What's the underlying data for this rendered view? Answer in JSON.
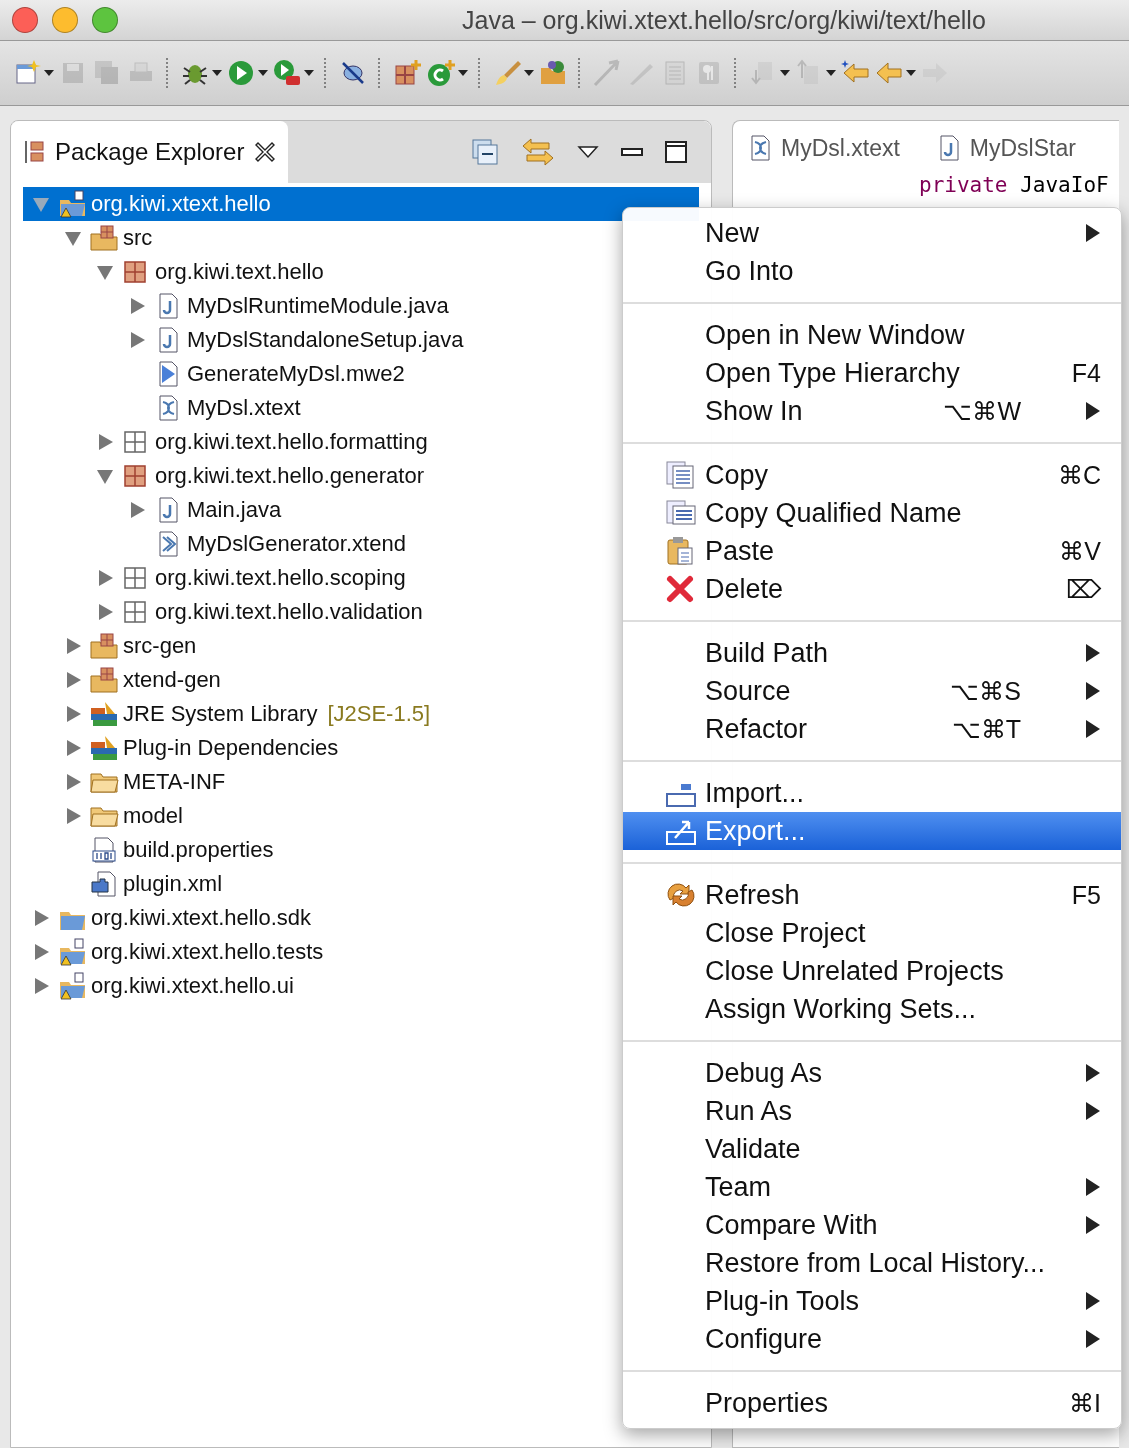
{
  "window": {
    "title": "Java – org.kiwi.xtext.hello/src/org/kiwi/text/hello"
  },
  "toolbar": [
    {
      "kind": "new",
      "disabled": false,
      "dropdown": true,
      "group_end": false
    },
    {
      "kind": "save",
      "disabled": true,
      "dropdown": false,
      "group_end": false
    },
    {
      "kind": "save-all",
      "disabled": true,
      "dropdown": false,
      "group_end": false
    },
    {
      "kind": "print",
      "disabled": true,
      "dropdown": false,
      "group_end": true
    },
    {
      "kind": "debug",
      "disabled": false,
      "dropdown": true,
      "group_end": false
    },
    {
      "kind": "run",
      "disabled": false,
      "dropdown": true,
      "group_end": false
    },
    {
      "kind": "run-tool",
      "disabled": false,
      "dropdown": true,
      "group_end": true
    },
    {
      "kind": "skip",
      "disabled": false,
      "dropdown": false,
      "group_end": true
    },
    {
      "kind": "new-package",
      "disabled": false,
      "dropdown": false,
      "group_end": false
    },
    {
      "kind": "new-class",
      "disabled": false,
      "dropdown": true,
      "group_end": true
    },
    {
      "kind": "brush",
      "disabled": false,
      "dropdown": true,
      "group_end": false
    },
    {
      "kind": "open-folder",
      "disabled": false,
      "dropdown": false,
      "group_end": true
    },
    {
      "kind": "annotation",
      "disabled": true,
      "dropdown": false,
      "group_end": false
    },
    {
      "kind": "pen",
      "disabled": true,
      "dropdown": false,
      "group_end": false
    },
    {
      "kind": "block",
      "disabled": true,
      "dropdown": false,
      "group_end": false
    },
    {
      "kind": "pilcrow",
      "disabled": true,
      "dropdown": false,
      "group_end": true
    },
    {
      "kind": "next",
      "disabled": true,
      "dropdown": true,
      "group_end": false
    },
    {
      "kind": "prev",
      "disabled": true,
      "dropdown": true,
      "group_end": false
    },
    {
      "kind": "last-edit",
      "disabled": false,
      "dropdown": false,
      "group_end": false
    },
    {
      "kind": "back",
      "disabled": false,
      "dropdown": true,
      "group_end": false
    },
    {
      "kind": "forward",
      "disabled": true,
      "dropdown": false,
      "group_end": false
    }
  ],
  "explorer": {
    "title": "Package Explorer",
    "tree": [
      {
        "label": "org.kiwi.xtext.hello",
        "kind": "project",
        "expanded": true,
        "selected": true,
        "children": [
          {
            "label": "src",
            "kind": "source-folder",
            "expanded": true,
            "selected": false,
            "children": [
              {
                "label": "org.kiwi.text.hello",
                "kind": "package",
                "expanded": true,
                "selected": false,
                "children": [
                  {
                    "label": "MyDslRuntimeModule.java",
                    "kind": "java",
                    "expanded": false,
                    "selected": false
                  },
                  {
                    "label": "MyDslStandaloneSetup.java",
                    "kind": "java",
                    "expanded": false,
                    "selected": false
                  },
                  {
                    "label": "GenerateMyDsl.mwe2",
                    "kind": "mwe2",
                    "selected": false
                  },
                  {
                    "label": "MyDsl.xtext",
                    "kind": "xtext",
                    "selected": false
                  }
                ]
              },
              {
                "label": "org.kiwi.text.hello.formatting",
                "kind": "package-outline",
                "expanded": false,
                "selected": false
              },
              {
                "label": "org.kiwi.text.hello.generator",
                "kind": "package",
                "expanded": true,
                "selected": false,
                "children": [
                  {
                    "label": "Main.java",
                    "kind": "java",
                    "expanded": false,
                    "selected": false
                  },
                  {
                    "label": "MyDslGenerator.xtend",
                    "kind": "xtend",
                    "selected": false
                  }
                ]
              },
              {
                "label": "org.kiwi.text.hello.scoping",
                "kind": "package-outline",
                "expanded": false,
                "selected": false
              },
              {
                "label": "org.kiwi.text.hello.validation",
                "kind": "package-outline",
                "expanded": false,
                "selected": false
              }
            ]
          },
          {
            "label": "src-gen",
            "kind": "source-folder",
            "expanded": false,
            "selected": false
          },
          {
            "label": "xtend-gen",
            "kind": "source-folder",
            "expanded": false,
            "selected": false
          },
          {
            "label": "JRE System Library",
            "decoration": "[J2SE-1.5]",
            "kind": "library",
            "expanded": false,
            "selected": false
          },
          {
            "label": "Plug-in Dependencies",
            "kind": "library",
            "expanded": false,
            "selected": false
          },
          {
            "label": "META-INF",
            "kind": "folder",
            "expanded": false,
            "selected": false
          },
          {
            "label": "model",
            "kind": "folder",
            "expanded": false,
            "selected": false
          },
          {
            "label": "build.properties",
            "kind": "properties",
            "selected": false
          },
          {
            "label": "plugin.xml",
            "kind": "plugin",
            "selected": false
          }
        ]
      },
      {
        "label": "org.kiwi.xtext.hello.sdk",
        "kind": "project-plain",
        "expanded": false,
        "selected": false
      },
      {
        "label": "org.kiwi.xtext.hello.tests",
        "kind": "project",
        "expanded": false,
        "selected": false
      },
      {
        "label": "org.kiwi.xtext.hello.ui",
        "kind": "project",
        "expanded": false,
        "selected": false
      }
    ]
  },
  "editor": {
    "tabs": [
      {
        "label": "MyDsl.xtext",
        "kind": "xtext"
      },
      {
        "label": "MyDslStar",
        "kind": "java"
      }
    ],
    "code_line": {
      "keyword": "private",
      "text": "JavaIoF"
    }
  },
  "context_menu": {
    "groups": [
      [
        {
          "label": "New",
          "submenu": true,
          "selected": false
        },
        {
          "label": "Go Into",
          "submenu": false,
          "selected": false
        }
      ],
      [
        {
          "label": "Open in New Window",
          "submenu": false,
          "selected": false
        },
        {
          "label": "Open Type Hierarchy",
          "shortcut": "F4",
          "submenu": false,
          "selected": false
        },
        {
          "label": "Show In",
          "shortcut": "⌥⌘W",
          "submenu": true,
          "selected": false
        }
      ],
      [
        {
          "label": "Copy",
          "kind": "copy",
          "shortcut": "⌘C",
          "submenu": false,
          "selected": false
        },
        {
          "label": "Copy Qualified Name",
          "kind": "copy-name",
          "submenu": false,
          "selected": false
        },
        {
          "label": "Paste",
          "kind": "paste",
          "shortcut": "⌘V",
          "submenu": false,
          "selected": false
        },
        {
          "label": "Delete",
          "kind": "delete",
          "shortcut": "⌦",
          "submenu": false,
          "selected": false
        }
      ],
      [
        {
          "label": "Build Path",
          "submenu": true,
          "selected": false
        },
        {
          "label": "Source",
          "shortcut": "⌥⌘S",
          "submenu": true,
          "selected": false
        },
        {
          "label": "Refactor",
          "shortcut": "⌥⌘T",
          "submenu": true,
          "selected": false
        }
      ],
      [
        {
          "label": "Import...",
          "kind": "import",
          "submenu": false,
          "selected": false
        },
        {
          "label": "Export...",
          "kind": "export",
          "submenu": false,
          "selected": true
        }
      ],
      [
        {
          "label": "Refresh",
          "kind": "refresh",
          "shortcut": "F5",
          "submenu": false,
          "selected": false
        },
        {
          "label": "Close Project",
          "submenu": false,
          "selected": false
        },
        {
          "label": "Close Unrelated Projects",
          "submenu": false,
          "selected": false
        },
        {
          "label": "Assign Working Sets...",
          "submenu": false,
          "selected": false
        }
      ],
      [
        {
          "label": "Debug As",
          "submenu": true,
          "selected": false
        },
        {
          "label": "Run As",
          "submenu": true,
          "selected": false
        },
        {
          "label": "Validate",
          "submenu": false,
          "selected": false
        },
        {
          "label": "Team",
          "submenu": true,
          "selected": false
        },
        {
          "label": "Compare With",
          "submenu": true,
          "selected": false
        },
        {
          "label": "Restore from Local History...",
          "submenu": false,
          "selected": false
        },
        {
          "label": "Plug-in Tools",
          "submenu": true,
          "selected": false
        },
        {
          "label": "Configure",
          "submenu": true,
          "selected": false
        }
      ],
      [
        {
          "label": "Properties",
          "shortcut": "⌘I",
          "submenu": false,
          "selected": false
        }
      ]
    ]
  }
}
